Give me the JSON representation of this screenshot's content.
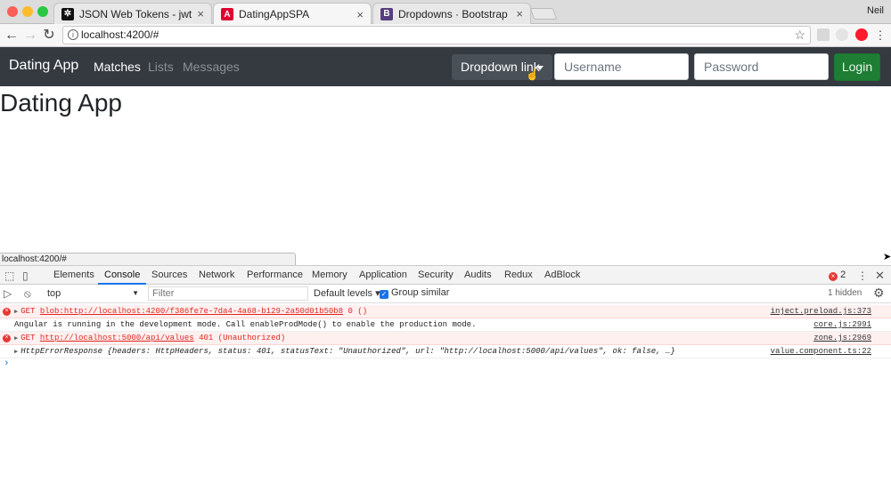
{
  "browser": {
    "tabs": [
      {
        "title": "JSON Web Tokens - jwt.io",
        "favicon": "jwt-icon"
      },
      {
        "title": "DatingAppSPA",
        "favicon": "angular-icon"
      },
      {
        "title": "Dropdowns · Bootstrap",
        "favicon": "bootstrap-icon"
      }
    ],
    "user": "Neil",
    "url": "localhost:4200/#",
    "status_url": "localhost:4200/#"
  },
  "app": {
    "brand": "Dating App",
    "nav": [
      "Matches",
      "Lists",
      "Messages"
    ],
    "dropdown_label": "Dropdown link",
    "username_placeholder": "Username",
    "password_placeholder": "Password",
    "login_label": "Login",
    "page_title": "Dating App"
  },
  "devtools": {
    "tabs": [
      "Elements",
      "Console",
      "Sources",
      "Network",
      "Performance",
      "Memory",
      "Application",
      "Security",
      "Audits",
      "Redux",
      "AdBlock"
    ],
    "error_count": "2",
    "context": "top",
    "filter_placeholder": "Filter",
    "levels": "Default levels",
    "group_similar": "Group similar",
    "hidden": "1 hidden",
    "messages": [
      {
        "method": "GET",
        "url": "blob:http://localhost:4200/f386fe7e-7da4-4a68-b129-2a50d01b50b8",
        "status": "0 ()",
        "source": "inject.preload.js:373"
      },
      {
        "text": "Angular is running in the development mode. Call enableProdMode() to enable the production mode.",
        "source": "core.js:2991"
      },
      {
        "method": "GET",
        "url": "http://localhost:5000/api/values",
        "status": "401 (Unauthorized)",
        "source": "zone.js:2969"
      },
      {
        "text": "HttpErrorResponse {headers: HttpHeaders, status: 401, statusText: \"Unauthorized\", url: \"http://localhost:5000/api/values\", ok: false, …}",
        "source": "value.component.ts:22"
      }
    ]
  },
  "colors": {
    "navbar": "#343a40",
    "login_button": "#1e7e34",
    "error_red": "#e0271f"
  }
}
